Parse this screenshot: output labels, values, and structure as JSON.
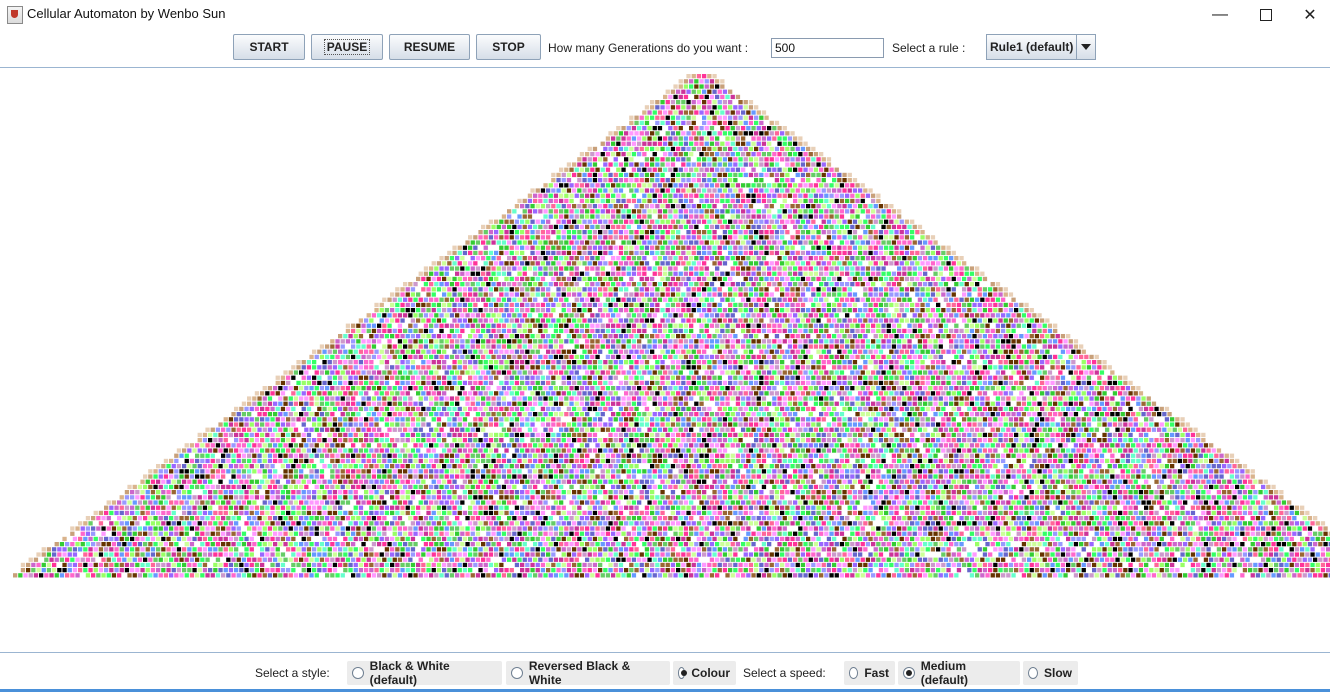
{
  "window": {
    "title": "Cellular Automaton by Wenbo Sun",
    "minimize": "—",
    "close": "✕"
  },
  "toolbar": {
    "start_label": "START",
    "pause_label": "PAUSE",
    "resume_label": "RESUME",
    "stop_label": "STOP",
    "generations_label": "How many Generations do you want :",
    "generations_value": "500",
    "rule_label": "Select a rule :",
    "rule_selected": "Rule1 (default)"
  },
  "automaton": {
    "palette": [
      "#ff66cc",
      "#66cc66",
      "#9966ff",
      "#33cc33",
      "#ff99ff",
      "#6699ff",
      "#cc66cc",
      "#99ff66",
      "#663300",
      "#000000",
      "#996633",
      "#cc99cc",
      "#66ffcc",
      "#ff3399",
      "#ccff99",
      "#9999ff",
      "#cc3399",
      "#33ff66",
      "#6666cc",
      "#ff6699"
    ],
    "edge_colors": [
      "#d9b38c",
      "#c8a07a",
      "#e8d0b8"
    ]
  },
  "bottom": {
    "style_label": "Select a style:",
    "styles": [
      "Black & White (default)",
      "Reversed Black & White",
      "Colour"
    ],
    "speed_label": "Select a speed:",
    "speeds": [
      "Fast",
      "Medium (default)",
      "Slow"
    ]
  }
}
